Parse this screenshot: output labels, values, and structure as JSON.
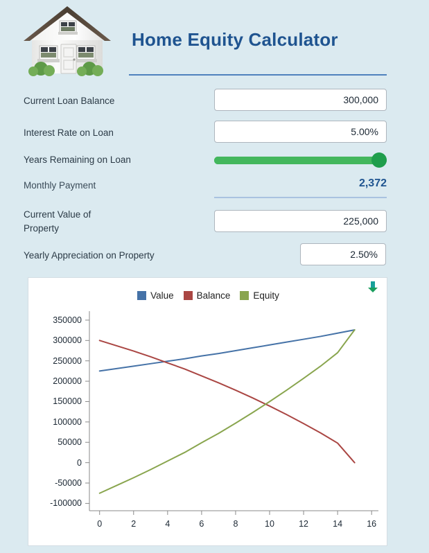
{
  "header": {
    "title": "Home Equity Calculator",
    "icon": "house-icon",
    "title_color": "#1f5490",
    "rule_color": "#4f81bd"
  },
  "background_color": "#dbeaf0",
  "form": {
    "rows": [
      {
        "label": "Current Loan Balance",
        "value": "300,000",
        "placeholder": "",
        "control": "text-input"
      },
      {
        "label": "Interest Rate on Loan",
        "value": "5.00%",
        "placeholder": "",
        "control": "text-input"
      },
      {
        "label": "Years Remaining on Loan",
        "value": "15",
        "placeholder": "",
        "control": "slider",
        "slider_percent": 100,
        "track_color": "#43b75d",
        "thumb_color": "#1f9e4c"
      },
      {
        "label": "Monthly Payment",
        "value": "2,372",
        "placeholder": "",
        "control": "readonly-output",
        "value_color": "#1f5490"
      },
      {
        "label": "Current Value of\nProperty",
        "value": "225,000",
        "placeholder": "",
        "control": "text-input"
      },
      {
        "label": "Yearly Appreciation on Property",
        "value": "2.50%",
        "placeholder": "",
        "control": "text-input"
      }
    ]
  },
  "chart_panel": {
    "download_icon": "download-arrow-icon",
    "download_icon_color": "#1a9e5e"
  },
  "chart_data": {
    "type": "line",
    "title": "",
    "xlabel": "",
    "ylabel": "",
    "xlim": [
      -0.6,
      16.4
    ],
    "ylim": [
      -118000,
      372000
    ],
    "grid": false,
    "legend_position": "top-center",
    "xticks": [
      0,
      2,
      4,
      6,
      8,
      10,
      12,
      14,
      16
    ],
    "xtick_labels": [
      "0",
      "2",
      "4",
      "6",
      "8",
      "10",
      "12",
      "14",
      "16"
    ],
    "yticks": [
      -100000,
      -50000,
      0,
      50000,
      100000,
      150000,
      200000,
      250000,
      300000,
      350000
    ],
    "ytick_labels": [
      "-100000",
      "-50000",
      "0",
      "50000",
      "100000",
      "150000",
      "200000",
      "250000",
      "300000",
      "350000"
    ],
    "x": [
      0,
      1,
      2,
      3,
      4,
      5,
      6,
      7,
      8,
      9,
      10,
      11,
      12,
      13,
      14,
      15
    ],
    "series": [
      {
        "name": "Value",
        "color": "#4572a7",
        "values": [
          225000,
          231000,
          237000,
          243000,
          249000,
          255000,
          262000,
          268000,
          275000,
          282000,
          289000,
          296000,
          303000,
          310000,
          318000,
          326000
        ]
      },
      {
        "name": "Balance",
        "color": "#aa4643",
        "values": [
          300000,
          287000,
          274000,
          260000,
          245000,
          230000,
          213000,
          196000,
          178000,
          159000,
          139000,
          118000,
          96000,
          73000,
          48000,
          0
        ]
      },
      {
        "name": "Equity",
        "color": "#89a54e",
        "values": [
          -75000,
          -56000,
          -37000,
          -17000,
          4000,
          25000,
          49000,
          72000,
          97000,
          123000,
          150000,
          178000,
          207000,
          237000,
          270000,
          326000
        ]
      }
    ]
  }
}
